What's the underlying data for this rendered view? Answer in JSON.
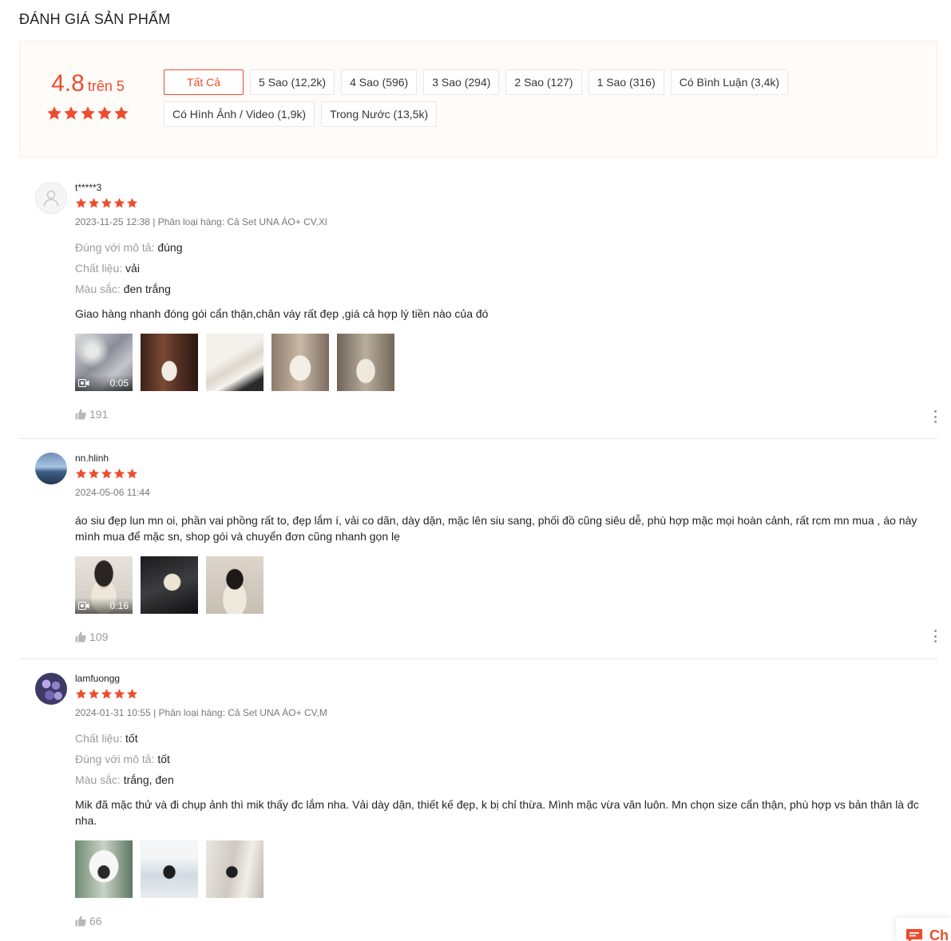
{
  "section_title": "ĐÁNH GIÁ SẢN PHẨM",
  "rating": {
    "score": "4.8",
    "suffix": "trên 5",
    "stars": 5,
    "color": "#ee4d2d"
  },
  "filters": [
    {
      "label": "Tất Cả",
      "active": true
    },
    {
      "label": "5 Sao (12,2k)",
      "active": false
    },
    {
      "label": "4 Sao (596)",
      "active": false
    },
    {
      "label": "3 Sao (294)",
      "active": false
    },
    {
      "label": "2 Sao (127)",
      "active": false
    },
    {
      "label": "1 Sao (316)",
      "active": false
    },
    {
      "label": "Có Bình Luận (3,4k)",
      "active": false
    },
    {
      "label": "Có Hình Ảnh / Video (1,9k)",
      "active": false
    },
    {
      "label": "Trong Nước (13,5k)",
      "active": false
    }
  ],
  "reviews": [
    {
      "username": "t*****3",
      "stars": 5,
      "meta": "2023-11-25 12:38 | Phân loại hàng: Cả Set UNA ÁO+ CV,Xl",
      "attributes": [
        {
          "label": "Đúng với mô tả:",
          "value": "đúng"
        },
        {
          "label": "Chất liệu:",
          "value": "vải"
        },
        {
          "label": "Màu sắc:",
          "value": "đen trắng"
        }
      ],
      "comment": "Giao hàng nhanh đóng gói cẩn thận,chân váy rất đẹp ,giá cả hợp lý tiền nào của đó",
      "video_duration": "0:05",
      "likes": "191"
    },
    {
      "username": "nn.hlinh",
      "stars": 5,
      "meta": "2024-05-06 11:44",
      "attributes": [],
      "comment": "áo siu đẹp lun mn oi, phần vai phồng rất to, đẹp lắm í, vải co dãn, dày dặn, mặc lên siu sang, phối đồ cũng siêu dễ, phù hợp mặc mọi hoàn cảnh, rất rcm mn mua , áo này mình mua để mặc sn, shop gói và chuyển đơn cũng nhanh gọn lẹ",
      "video_duration": "0:16",
      "likes": "109"
    },
    {
      "username": "lamfuongg",
      "stars": 5,
      "meta": "2024-01-31 10:55 | Phân loại hàng: Cả Set UNA ÁO+ CV,M",
      "attributes": [
        {
          "label": "Chất liệu:",
          "value": "tốt"
        },
        {
          "label": "Đúng với mô tả:",
          "value": "tốt"
        },
        {
          "label": "Màu sắc:",
          "value": "trắng, đen"
        }
      ],
      "comment": "Mik đã mặc thử và đi chụp ảnh thì mik thấy đc lắm nha. Vải dày dặn, thiết kế đẹp, k bị chỉ thừa. Mình mặc vừa văn luôn. Mn chọn size cẩn thận, phù hợp vs bản thân là đc nha.",
      "video_duration": "",
      "likes": "66"
    }
  ],
  "chat": {
    "label": "Ch"
  }
}
